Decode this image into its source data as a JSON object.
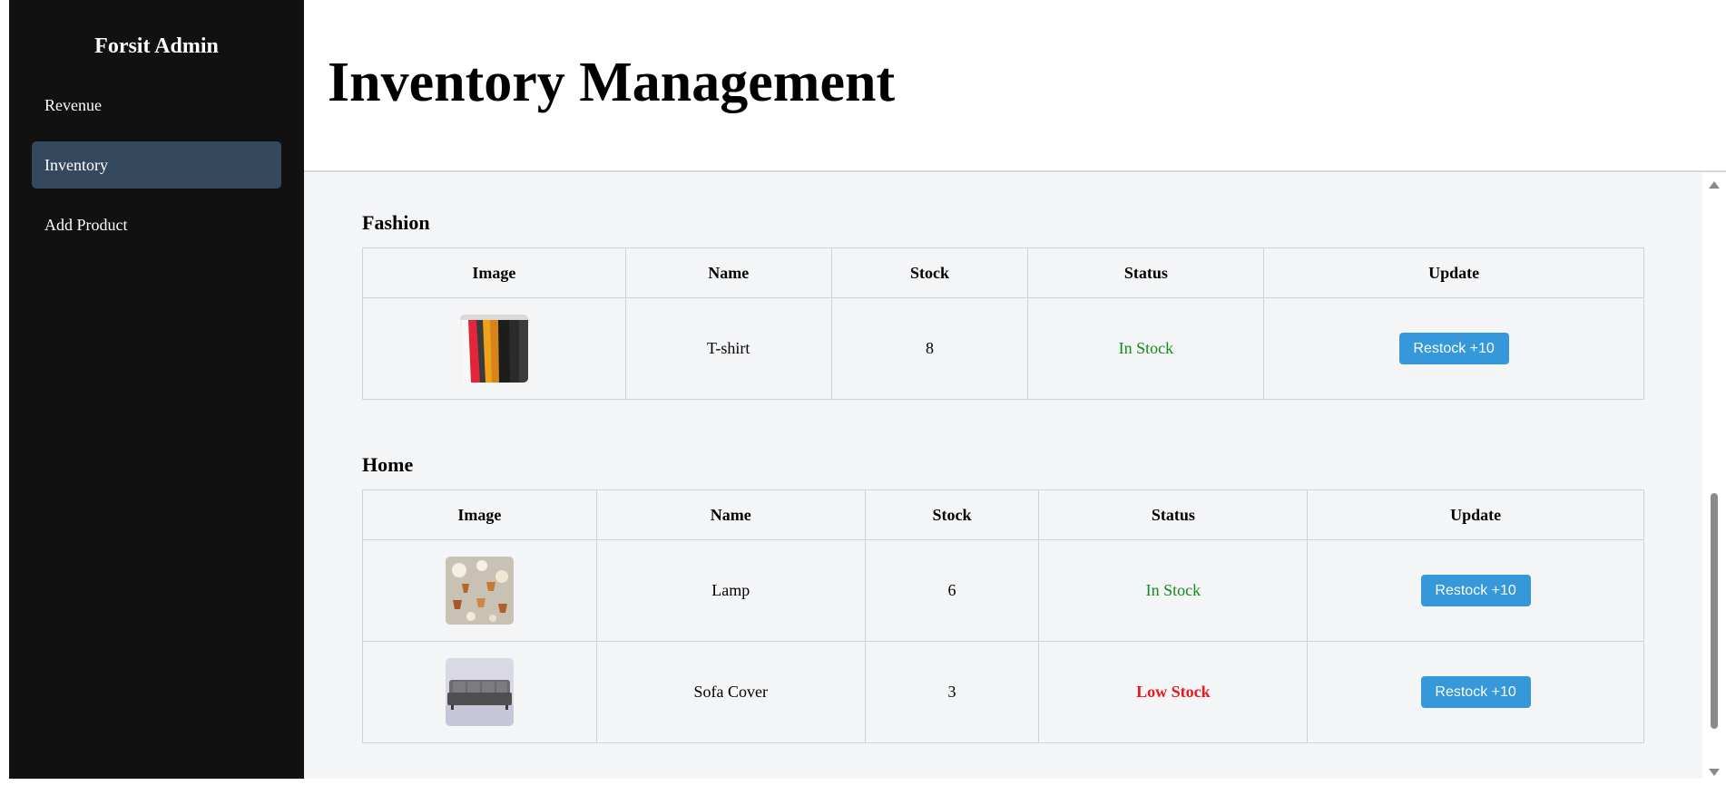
{
  "sidebar": {
    "brand": "Forsit Admin",
    "items": [
      {
        "label": "Revenue",
        "active": false
      },
      {
        "label": "Inventory",
        "active": true
      },
      {
        "label": "Add Product",
        "active": false
      }
    ]
  },
  "header": {
    "title": "Inventory Management"
  },
  "columns": [
    "Image",
    "Name",
    "Stock",
    "Status",
    "Update"
  ],
  "sections": [
    {
      "title": "Fashion",
      "rows": [
        {
          "image": "tshirt-rack-image",
          "name": "T-shirt",
          "stock": "8",
          "status": "In Stock",
          "button": "Restock +10"
        }
      ]
    },
    {
      "title": "Home",
      "rows": [
        {
          "image": "lamp-image",
          "name": "Lamp",
          "stock": "6",
          "status": "In Stock",
          "button": "Restock +10"
        },
        {
          "image": "sofa-cover-image",
          "name": "Sofa Cover",
          "stock": "3",
          "status": "Low Stock",
          "button": "Restock +10"
        }
      ]
    }
  ],
  "colors": {
    "sidebar_bg": "#111111",
    "active_nav": "#34495e",
    "accent_button": "#3498db",
    "in_stock": "#138a1c",
    "low_stock": "#e8181e",
    "content_bg": "#f4f5f7"
  }
}
